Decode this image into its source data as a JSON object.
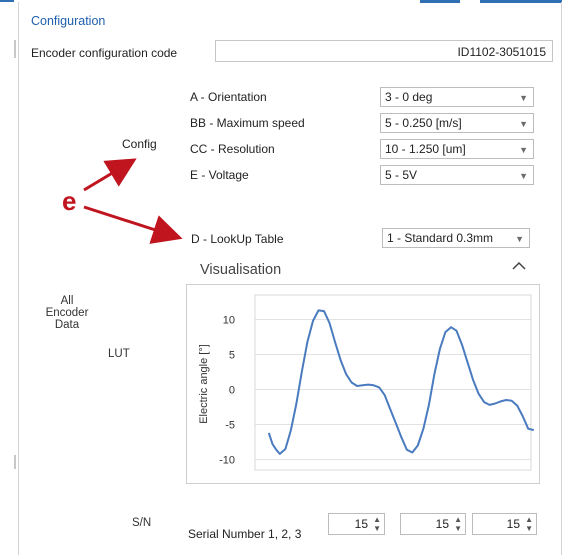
{
  "section_title": "Configuration",
  "encoder": {
    "label": "Encoder configuration code",
    "value": "ID1102-3051015"
  },
  "config_label": "Config",
  "rows": [
    {
      "label": "A - Orientation",
      "value": "3 - 0 deg"
    },
    {
      "label": "BB - Maximum speed",
      "value": "5 - 0.250 [m/s]"
    },
    {
      "label": "CC - Resolution",
      "value": "10 - 1.250 [um]"
    },
    {
      "label": "E - Voltage",
      "value": "5 - 5V"
    }
  ],
  "lookup": {
    "label": "D - LookUp Table",
    "value": "1 - Standard 0.3mm"
  },
  "annotation": "e",
  "visualisation": {
    "title": "Visualisation",
    "collapse_icon": "chevron-up-icon"
  },
  "all_encoder_data_label": "All\nEncoder\nData",
  "lut_label": "LUT",
  "sn_label": "S/N",
  "serial": {
    "label": "Serial Number 1, 2, 3",
    "values": [
      "15",
      "15",
      "15"
    ]
  },
  "colors": {
    "accent": "#1e5fae",
    "annotation": "#c0151f",
    "line": "#4a7bbf"
  },
  "chart_data": {
    "type": "line",
    "ylabel": "Electric angle [°]",
    "xlabel": "",
    "ylim": [
      -11.5,
      13.5
    ],
    "yticks": [
      10,
      5,
      0,
      -5,
      -10
    ],
    "grid": true,
    "series": [
      {
        "x": [
          0,
          0.01,
          0.02,
          0.03,
          0.045,
          0.06,
          0.075,
          0.09,
          0.105,
          0.12,
          0.135,
          0.15,
          0.165,
          0.18,
          0.195,
          0.21,
          0.225,
          0.24,
          0.255,
          0.27,
          0.285,
          0.3,
          0.315,
          0.33,
          0.345,
          0.36,
          0.375,
          0.39,
          0.405,
          0.42,
          0.435,
          0.45,
          0.465,
          0.48,
          0.495,
          0.51,
          0.525,
          0.54,
          0.555,
          0.57,
          0.585,
          0.6,
          0.615,
          0.63,
          0.645,
          0.66,
          0.675,
          0.69,
          0.705,
          0.72,
          0.735,
          0.75,
          0.765,
          0.78,
          0.795,
          0.81,
          0.825,
          0.84,
          0.855,
          0.87,
          0.885,
          0.9,
          0.915,
          0.93,
          0.945,
          0.96,
          0.975,
          1.0
        ],
        "y": [
          -6.2,
          -7.8,
          -8.6,
          -9.2,
          -8.5,
          -5.8,
          -2.0,
          2.6,
          6.8,
          9.8,
          11.3,
          11.2,
          9.5,
          6.8,
          4.2,
          2.2,
          1.0,
          0.5,
          0.6,
          0.7,
          0.6,
          0.3,
          -0.8,
          -2.8,
          -4.8,
          -6.8,
          -8.6,
          -9.0,
          -8.0,
          -5.6,
          -2.2,
          2.2,
          5.8,
          8.2,
          8.9,
          8.4,
          6.4,
          3.9,
          1.4,
          -0.6,
          -1.8,
          -2.2,
          -2.0,
          -1.7,
          -1.5,
          -1.6,
          -2.3,
          -3.8,
          -5.6,
          -5.8,
          -5.8,
          -5.8,
          -5.8,
          -5.8,
          -5.8,
          -5.8,
          -5.8,
          -5.8,
          -5.8,
          -5.8,
          -5.8,
          -5.8,
          -5.8,
          -5.8,
          -5.8,
          -5.8,
          -5.8,
          -5.8
        ]
      }
    ]
  }
}
